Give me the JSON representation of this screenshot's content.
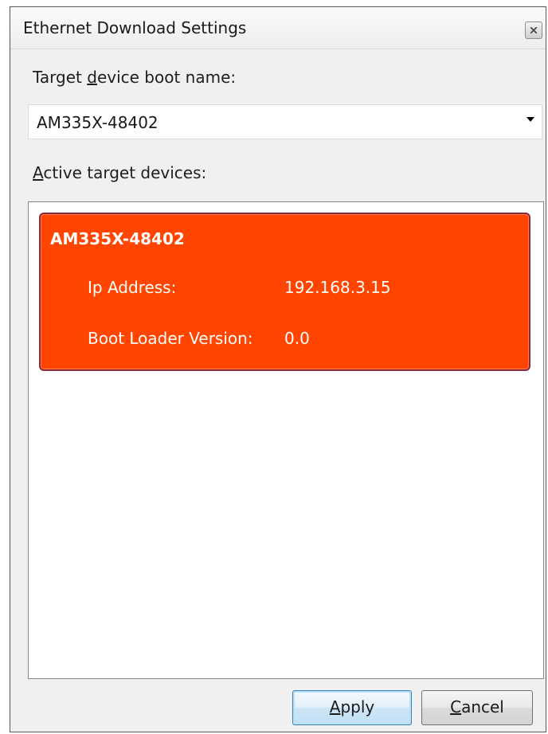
{
  "window": {
    "title": "Ethernet Download Settings"
  },
  "boot_name": {
    "label_before": "Target ",
    "label_accel": "d",
    "label_after": "evice boot name:",
    "selected_value": "AM335X-48402"
  },
  "active_devices": {
    "label_accel": "A",
    "label_after": "ctive target devices:",
    "items": [
      {
        "name": "AM335X-48402",
        "ip_label": "Ip Address:",
        "ip_value": "192.168.3.15",
        "bootloader_label": "Boot Loader Version:",
        "bootloader_value": "0.0"
      }
    ]
  },
  "buttons": {
    "apply_accel": "A",
    "apply_rest": "pply",
    "cancel_accel": "C",
    "cancel_rest": "ancel"
  },
  "colors": {
    "selected_card": "#ff4500",
    "card_border": "#8a2a3c",
    "default_button_border": "#3c7fb1"
  },
  "icons": {
    "close": "close-icon",
    "dropdown": "dropdown-arrow-icon"
  }
}
